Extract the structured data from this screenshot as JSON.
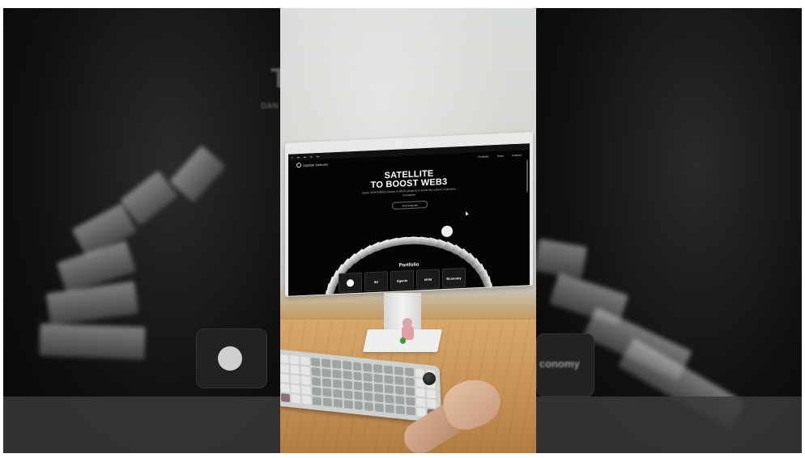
{
  "screen": {
    "site_name": "Satellite Ventures",
    "nav_links": [
      "Portfolio",
      "Team",
      "Contact"
    ],
    "hero_line1": "SATELLITE",
    "hero_line2": "TO BOOST WEB3",
    "hero_subtitle": "Some VENTURES invests in Web3 projects to boost the culture of genuine innovation",
    "cta_label": "Send proposal",
    "portfolio_heading": "Portfolio",
    "portfolio_logos": [
      "✓",
      "SU",
      "Agents",
      "NYM",
      "Bconomy"
    ]
  },
  "blurred_side": {
    "left_heading": "T",
    "left_subheading": "DAN",
    "right_logo_text": "conomy"
  },
  "colors": {
    "screen_bg": "#050505",
    "desk": "#c38f55",
    "wall": "#d4d6d2"
  }
}
